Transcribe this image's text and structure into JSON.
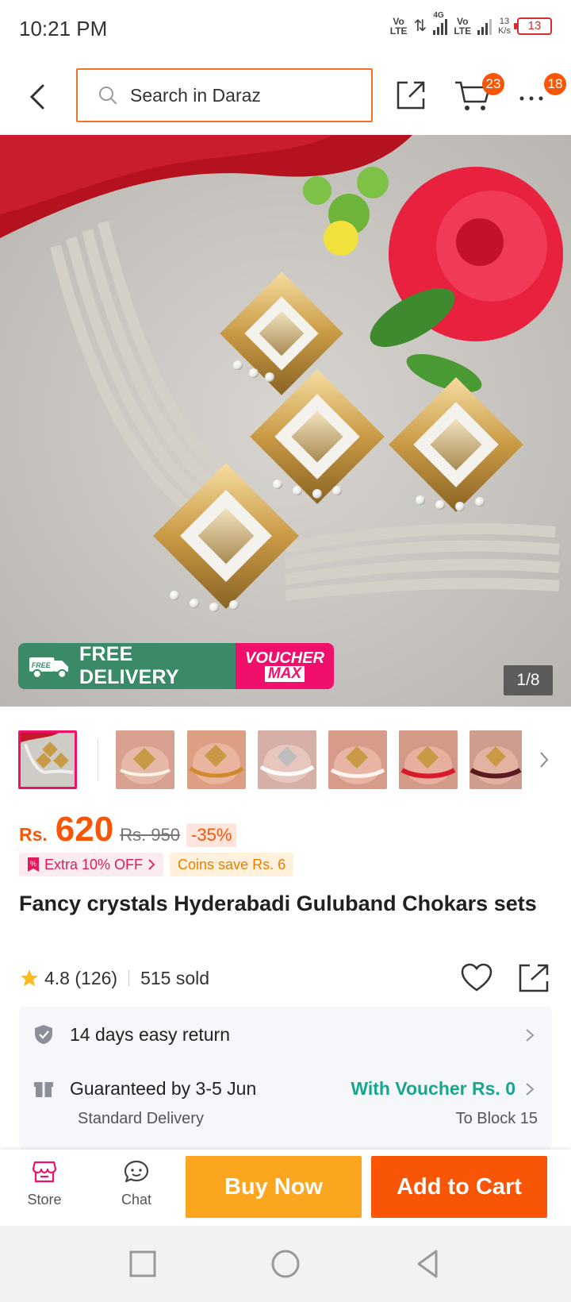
{
  "status_bar": {
    "time": "10:21 PM",
    "sim1": "Vo\nLTE",
    "net": "4G",
    "sim2": "Vo\nLTE",
    "speed": "13\nK/s",
    "battery": "13"
  },
  "header": {
    "search_placeholder": "Search in Daraz",
    "cart_count": "23",
    "more_count": "18"
  },
  "gallery": {
    "promo_free_icon_text": "FREE",
    "promo_free_delivery": "FREE DELIVERY",
    "promo_voucher_line1": "VOUCHER",
    "promo_voucher_line2": "MAX",
    "counter": "1/8",
    "thumbnail_count": 7
  },
  "price": {
    "currency": "Rs.",
    "current": "620",
    "original": "Rs. 950",
    "discount": "-35%"
  },
  "offers": {
    "extra_off": "Extra 10% OFF",
    "coins": "Coins save Rs. 6"
  },
  "product": {
    "title": "Fancy crystals Hyderabadi Guluband Chokars sets",
    "rating": "4.8 (126)",
    "sold": "515 sold"
  },
  "services": {
    "return_text": "14 days easy return",
    "delivery_text": "Guaranteed by 3-5 Jun",
    "delivery_sub": "Standard Delivery",
    "voucher_text": "With Voucher Rs. 0",
    "location": "To Block 15"
  },
  "bottom_bar": {
    "store_label": "Store",
    "chat_label": "Chat",
    "buy_now": "Buy Now",
    "add_to_cart": "Add to Cart"
  },
  "colors": {
    "accent": "#f85606",
    "buy_now": "#fca61f",
    "voucher_green": "#19a58f",
    "promo_green": "#3a8a68",
    "promo_pink": "#f0106b"
  }
}
